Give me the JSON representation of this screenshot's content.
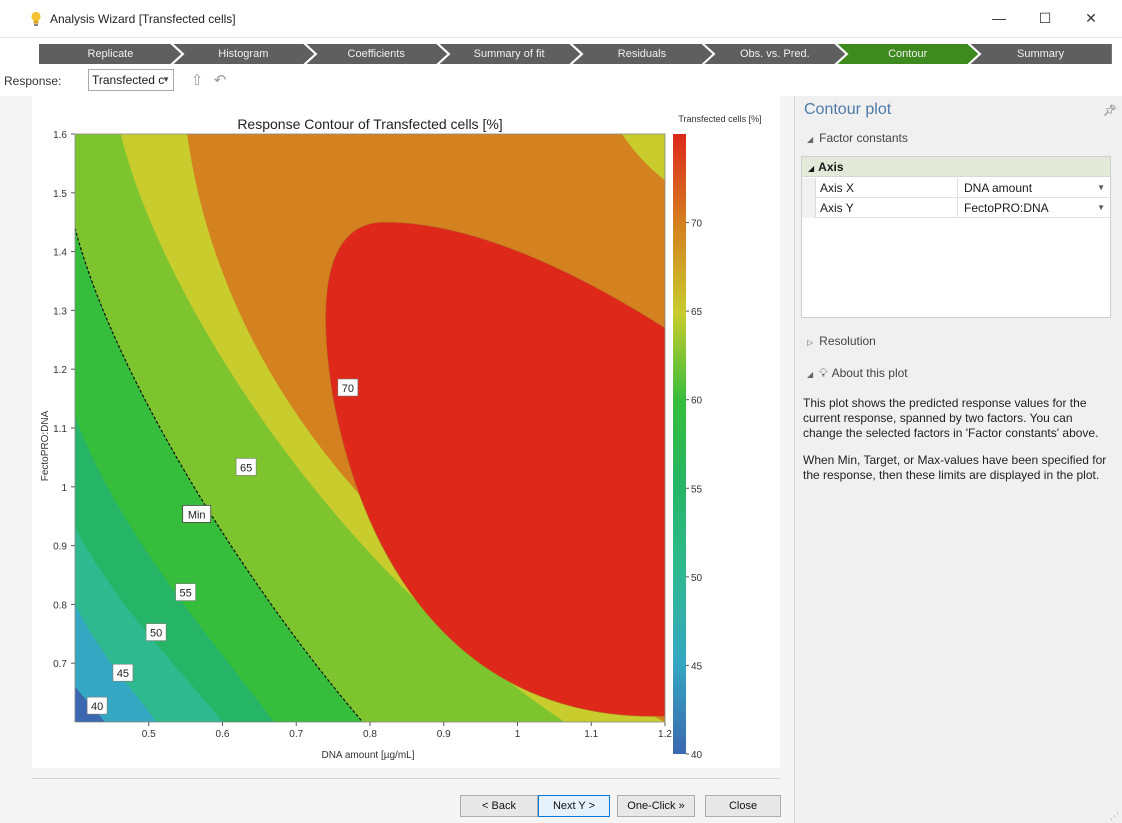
{
  "window": {
    "title": "Analysis Wizard [Transfected cells]",
    "minimize_glyph": "—",
    "maximize_glyph": "☐",
    "close_glyph": "✕",
    "icon": "lightbulb-icon"
  },
  "stepper": {
    "steps": [
      {
        "label": "Replicate",
        "active": false
      },
      {
        "label": "Histogram",
        "active": false
      },
      {
        "label": "Coefficients",
        "active": false
      },
      {
        "label": "Summary of fit",
        "active": false
      },
      {
        "label": "Residuals",
        "active": false
      },
      {
        "label": "Obs. vs. Pred.",
        "active": false
      },
      {
        "label": "Contour",
        "active": true
      },
      {
        "label": "Summary",
        "active": false
      }
    ],
    "colors": {
      "inactive": "#5f5f5f",
      "active": "#3f8a1f"
    }
  },
  "toolbar": {
    "response_label": "Response:",
    "response_value": "Transfected c",
    "icons": [
      "export-icon",
      "undo-icon"
    ]
  },
  "chart_data": {
    "type": "contour",
    "title": "Response Contour of Transfected cells [%]",
    "xlabel": "DNA amount [µg/mL]",
    "ylabel": "FectoPRO:DNA",
    "xlim": [
      0.4,
      1.2
    ],
    "ylim": [
      0.6,
      1.6
    ],
    "xticks": [
      0.5,
      0.6,
      0.7,
      0.8,
      0.9,
      1,
      1.1,
      1.2
    ],
    "ytick_labels": [
      "1.6",
      "1.5",
      "1.4",
      "1.3",
      "1.2",
      "1.1",
      "1",
      "0.9",
      "0.8",
      "0.7"
    ],
    "contour_levels": [
      40,
      45,
      50,
      55,
      60,
      65,
      70
    ],
    "contour_labels": [
      "40",
      "45",
      "50",
      "55",
      "65",
      "70"
    ],
    "min_line_label": "Min",
    "level_colors": {
      "below_40": "#3b68b0",
      "40-45": "#34a8c2",
      "45-50": "#2fb98e",
      "50-55": "#26b566",
      "55-60": "#35bd3b",
      "60-65": "#7dc42f",
      "65-70": "#c8cc2d",
      "70-75": "#d4821f",
      "above_75": "#dd281a"
    },
    "colorbar": {
      "title": "Transfected cells [%]",
      "range": [
        40,
        75
      ],
      "tick_labels": [
        "70",
        "65",
        "60",
        "55",
        "50",
        "45",
        "40"
      ]
    }
  },
  "buttons": {
    "back": "< Back",
    "next": "Next Y >",
    "oneclick": "One-Click »",
    "close": "Close"
  },
  "panel": {
    "title": "Contour plot",
    "factor_constants": "Factor constants",
    "axis_header": "Axis",
    "axis_rows": [
      {
        "key": "Axis X",
        "value": "DNA amount"
      },
      {
        "key": "Axis Y",
        "value": "FectoPRO:DNA"
      }
    ],
    "resolution": "Resolution",
    "about": "About this plot",
    "about_p1": "This plot shows the predicted response values for the current response, spanned by two factors. You can change the selected factors in 'Factor constants' above.",
    "about_p2": "When Min, Target, or Max-values have been specified for the response, then these limits are displayed in the plot."
  }
}
